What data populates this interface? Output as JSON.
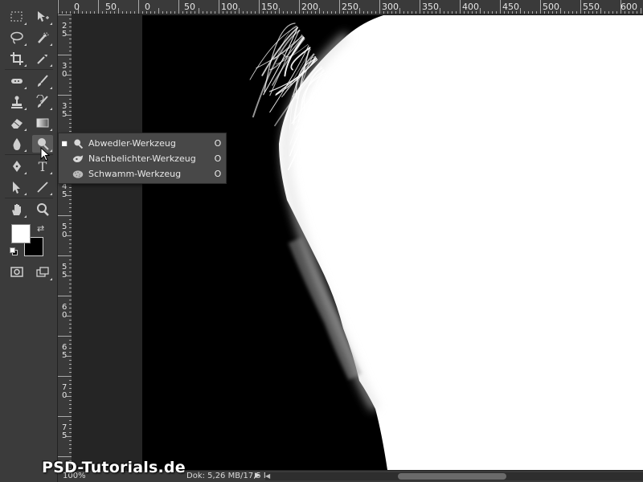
{
  "ruler_top": {
    "labels": [
      "0",
      "50",
      "0",
      "50",
      "100",
      "150",
      "200",
      "250",
      "300",
      "350",
      "400",
      "450",
      "500",
      "550",
      "600"
    ]
  },
  "ruler_left": {
    "labels": [
      "2",
      "5",
      "3",
      "0",
      "3",
      "5",
      "4",
      "0",
      "4",
      "5",
      "5",
      "0",
      "5",
      "5",
      "6",
      "0",
      "6",
      "5",
      "7",
      "0",
      "7",
      "5"
    ]
  },
  "toolbar": {
    "tools": [
      {
        "name": "rectangular-marquee-tool",
        "icon": "marquee-icon"
      },
      {
        "name": "move-tool",
        "icon": "move-icon"
      },
      {
        "name": "lasso-tool",
        "icon": "lasso-icon"
      },
      {
        "name": "quick-selection-tool",
        "icon": "quick-selection-icon"
      },
      {
        "name": "crop-tool",
        "icon": "crop-icon"
      },
      {
        "name": "eyedropper-tool",
        "icon": "eyedropper-icon"
      },
      {
        "name": "spot-healing-tool",
        "icon": "healing-icon"
      },
      {
        "name": "brush-tool",
        "icon": "brush-icon"
      },
      {
        "name": "clone-stamp-tool",
        "icon": "stamp-icon"
      },
      {
        "name": "history-brush-tool",
        "icon": "history-brush-icon"
      },
      {
        "name": "eraser-tool",
        "icon": "eraser-icon"
      },
      {
        "name": "gradient-tool",
        "icon": "gradient-icon"
      },
      {
        "name": "blur-tool",
        "icon": "blur-icon"
      },
      {
        "name": "dodge-tool",
        "icon": "dodge-icon"
      },
      {
        "name": "pen-tool",
        "icon": "pen-icon"
      },
      {
        "name": "type-tool",
        "icon": "type-icon"
      },
      {
        "name": "path-selection-tool",
        "icon": "path-selection-icon"
      },
      {
        "name": "line-tool",
        "icon": "line-icon"
      },
      {
        "name": "hand-tool",
        "icon": "hand-icon"
      },
      {
        "name": "zoom-tool",
        "icon": "zoom-icon"
      }
    ],
    "type_glyph": "T",
    "foreground_color": "#ffffff",
    "background_color": "#000000"
  },
  "flyout": {
    "items": [
      {
        "label": "Abwedler-Werkzeug",
        "shortcut": "O",
        "icon": "dodge-icon",
        "selected": true
      },
      {
        "label": "Nachbelichter-Werkzeug",
        "shortcut": "O",
        "icon": "burn-icon",
        "selected": false
      },
      {
        "label": "Schwamm-Werkzeug",
        "shortcut": "O",
        "icon": "sponge-icon",
        "selected": false
      }
    ]
  },
  "status": {
    "zoom": "100%",
    "doc_size": "Dok: 5,26 MB/17,5 MB"
  },
  "watermark": "PSD-Tutorials.de"
}
